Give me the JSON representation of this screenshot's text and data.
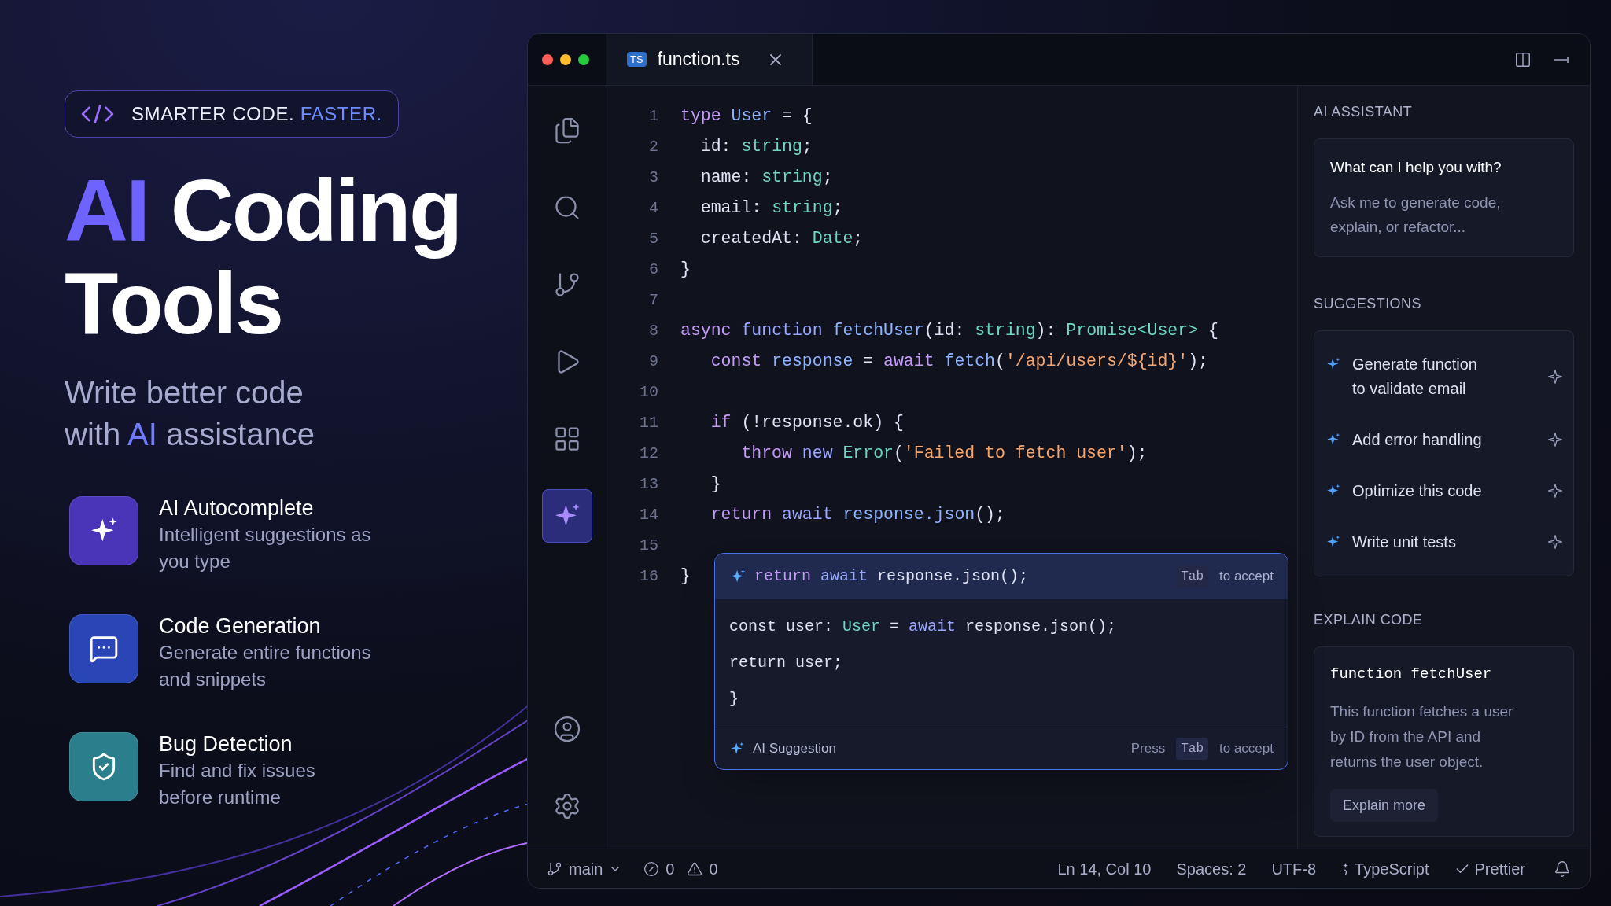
{
  "hero": {
    "tagline": {
      "main": "SMARTER CODE.",
      "accent": "FASTER."
    },
    "headline": [
      {
        "text": "AI",
        "accent": true
      },
      {
        "text": "Coding",
        "accent": false
      },
      {
        "text": "Tools",
        "accent": false
      }
    ],
    "subtitle": [
      {
        "text": "Write better code with",
        "accent": false
      },
      {
        "text": "AI",
        "accent": true
      },
      {
        "text": "assistance",
        "accent": false
      }
    ],
    "features": [
      {
        "kind": "sparkle",
        "title": "AI Autocomplete",
        "description_lines": [
          "Intelligent suggestions as",
          "you type"
        ]
      },
      {
        "kind": "chat",
        "title": "Code Generation",
        "description_lines": [
          "Generate entire functions",
          "and snippets"
        ]
      },
      {
        "kind": "shield",
        "title": "Bug Detection",
        "description_lines": [
          "Find and fix issues",
          "before runtime"
        ]
      }
    ]
  },
  "editor": {
    "tab": {
      "badge": "TS",
      "title": "function.ts"
    },
    "activity_bar": [
      {
        "kind": "files",
        "selected": false
      },
      {
        "kind": "search",
        "selected": false
      },
      {
        "kind": "branch",
        "selected": false
      },
      {
        "kind": "run",
        "selected": false
      },
      {
        "kind": "extensions",
        "selected": false
      },
      {
        "kind": "ai",
        "selected": true
      }
    ],
    "activity_bar_bottom": [
      {
        "kind": "account"
      },
      {
        "kind": "settings"
      }
    ],
    "lines": [
      {
        "number": "1",
        "tokens": [
          {
            "kind": "kw",
            "text": "type "
          },
          {
            "kind": "fn",
            "text": "User"
          },
          {
            "kind": "p",
            "text": " = {"
          }
        ]
      },
      {
        "number": "2",
        "tokens": [
          {
            "kind": "p",
            "text": "  id: "
          },
          {
            "kind": "ty",
            "text": "string"
          },
          {
            "kind": "p",
            "text": ";"
          }
        ]
      },
      {
        "number": "3",
        "tokens": [
          {
            "kind": "p",
            "text": "  name: "
          },
          {
            "kind": "ty",
            "text": "string"
          },
          {
            "kind": "p",
            "text": ";"
          }
        ]
      },
      {
        "number": "4",
        "tokens": [
          {
            "kind": "p",
            "text": "  email: "
          },
          {
            "kind": "ty",
            "text": "string"
          },
          {
            "kind": "p",
            "text": ";"
          }
        ]
      },
      {
        "number": "5",
        "tokens": [
          {
            "kind": "p",
            "text": "  createdAt: "
          },
          {
            "kind": "ty",
            "text": "Date"
          },
          {
            "kind": "p",
            "text": ";"
          }
        ]
      },
      {
        "number": "6",
        "tokens": [
          {
            "kind": "p",
            "text": "}"
          }
        ]
      },
      {
        "number": "7"
      },
      {
        "number": "8",
        "tokens": [
          {
            "kind": "kw",
            "text": "async "
          },
          {
            "kind": "kw2",
            "text": "function "
          },
          {
            "kind": "fn",
            "text": "fetchUser"
          },
          {
            "kind": "p",
            "text": "(id: "
          },
          {
            "kind": "ty",
            "text": "string"
          },
          {
            "kind": "p",
            "text": "): "
          },
          {
            "kind": "ty",
            "text": "Promise<User>"
          },
          {
            "kind": "p",
            "text": " {"
          }
        ]
      },
      {
        "number": "9",
        "tokens": [
          {
            "kind": "kw",
            "text": "   const "
          },
          {
            "kind": "fn",
            "text": "response"
          },
          {
            "kind": "p",
            "text": " = "
          },
          {
            "kind": "kw",
            "text": "await "
          },
          {
            "kind": "fn",
            "text": "fetch"
          },
          {
            "kind": "p",
            "text": "("
          },
          {
            "kind": "str",
            "text": "'/api/users/${id}'"
          },
          {
            "kind": "p",
            "text": ");"
          }
        ]
      },
      {
        "number": "10"
      },
      {
        "number": "11",
        "tokens": [
          {
            "kind": "kw",
            "text": "   if"
          },
          {
            "kind": "p",
            "text": " (!response.ok) {"
          }
        ]
      },
      {
        "number": "12",
        "tokens": [
          {
            "kind": "kw",
            "text": "      throw "
          },
          {
            "kind": "kw2",
            "text": "new "
          },
          {
            "kind": "ty",
            "text": "Error"
          },
          {
            "kind": "p",
            "text": "("
          },
          {
            "kind": "str",
            "text": "'Failed to fetch user'"
          },
          {
            "kind": "p",
            "text": ");"
          }
        ]
      },
      {
        "number": "13",
        "tokens": [
          {
            "kind": "p",
            "text": "   }"
          }
        ]
      },
      {
        "number": "14",
        "tokens": [
          {
            "kind": "kw",
            "text": "   return "
          },
          {
            "kind": "kw2",
            "text": "await "
          },
          {
            "kind": "fn",
            "text": "response.json"
          },
          {
            "kind": "p",
            "text": "();"
          }
        ]
      },
      {
        "number": "15"
      },
      {
        "number": "16",
        "tokens": [
          {
            "kind": "p",
            "text": "}"
          }
        ]
      }
    ],
    "suggestion_popup": {
      "header_tokens": [
        {
          "kind": "kw",
          "text": "return "
        },
        {
          "kind": "kw2",
          "text": "await "
        },
        {
          "kind": "p",
          "text": "response.json();"
        }
      ],
      "header_hint": {
        "key": "Tab",
        "text": "to accept"
      },
      "lines": [
        {
          "tokens": [
            {
              "kind": "p",
              "text": "const user: "
            },
            {
              "kind": "ty",
              "text": "User"
            },
            {
              "kind": "p",
              "text": " = "
            },
            {
              "kind": "kw2",
              "text": "await"
            },
            {
              "kind": "p",
              "text": " response.json();"
            }
          ]
        },
        {
          "tokens": [
            {
              "kind": "p",
              "text": "return user;"
            }
          ]
        },
        {
          "tokens": [
            {
              "kind": "p",
              "text": "}"
            }
          ]
        }
      ],
      "footer_label": "AI Suggestion",
      "footer_hint": {
        "before": "Press",
        "key": "Tab",
        "after": "to accept"
      }
    }
  },
  "assistant": {
    "title": "AI ASSISTANT",
    "prompt_card": {
      "heading": "What can I help you with?",
      "text_lines": [
        "Ask me to generate code,",
        "explain, or refactor..."
      ]
    },
    "suggestions_title": "SUGGESTIONS",
    "suggestions": [
      {
        "lines": [
          "Generate function",
          "to validate email"
        ]
      },
      {
        "lines": [
          "Add error handling"
        ]
      },
      {
        "lines": [
          "Optimize this code"
        ]
      },
      {
        "lines": [
          "Write unit tests"
        ]
      }
    ],
    "explain_title": "EXPLAIN CODE",
    "explain_card": {
      "code": "function fetchUser",
      "text_lines": [
        "This function fetches a user",
        "by ID from the API and",
        "returns the user object."
      ],
      "button": "Explain more"
    }
  },
  "status_bar": {
    "branch": "main",
    "errors": "0",
    "warnings": "0",
    "position": "Ln 14, Col 10",
    "spaces": "Spaces: 2",
    "encoding": "UTF-8",
    "language": "TypeScript",
    "formatter": "Prettier"
  }
}
